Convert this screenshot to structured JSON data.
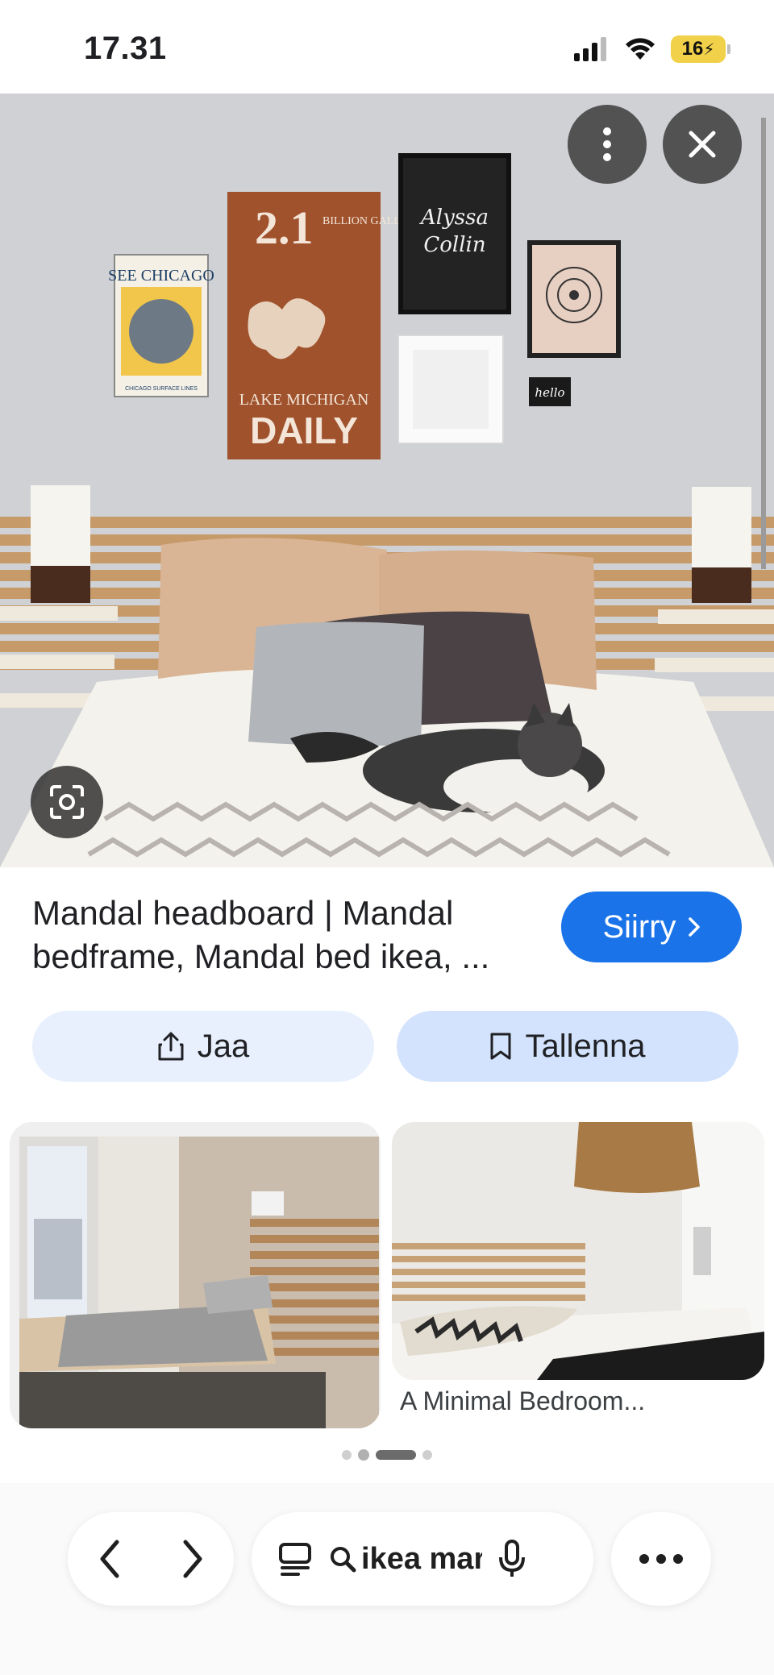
{
  "status_bar": {
    "time": "17.31",
    "battery": "16"
  },
  "hero": {
    "alt": "Bedroom with Mandal headboard, wall art and a cat on the bed",
    "wall_art": {
      "poster_1_title": "SEE CHICAGO",
      "poster_1_sub": "CHICAGO SURFACE LINES",
      "poster_2_line1": "2.1",
      "poster_2_line2": "BILLION GALLONS",
      "poster_2_line3": "LAKE MICHIGAN",
      "poster_2_line4": "DAILY",
      "poster_3_line1": "Alyssa",
      "poster_3_line2": "Collin",
      "sign_small": "hello"
    },
    "icons": {
      "more": "more-vertical-icon",
      "close": "close-icon",
      "lens": "lens-icon"
    }
  },
  "result": {
    "title": "Mandal headboard | Mandal bedframe, Mandal bed ikea, ...",
    "visit_label": "Siirry"
  },
  "actions": {
    "share_label": "Jaa",
    "save_label": "Tallenna"
  },
  "related": {
    "right_caption": "A Minimal Bedroom..."
  },
  "bottom_bar": {
    "search_text": "ikea mar"
  },
  "colors": {
    "accent": "#1a73e8",
    "share_bg": "#e8f0fe",
    "save_bg": "#d3e3fd"
  }
}
